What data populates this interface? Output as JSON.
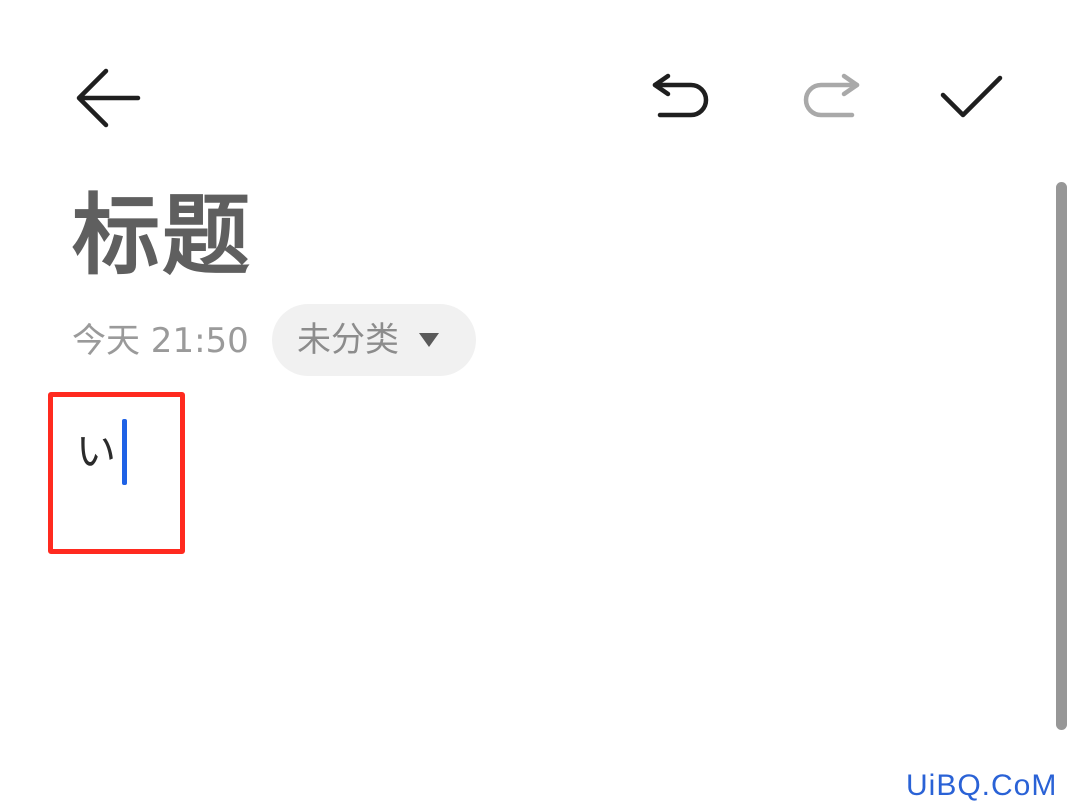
{
  "toolbar": {
    "back_icon": "arrow-left-icon",
    "undo_icon": "undo-icon",
    "redo_icon": "redo-icon",
    "save_icon": "check-icon",
    "icon_color": "#1f1f1f",
    "redo_disabled_color": "#a9a9a9"
  },
  "note": {
    "title": "标题",
    "time": "今天 21:50",
    "category": "未分类",
    "category_icon": "dropdown-triangle-icon",
    "body": "い"
  },
  "watermark": "UiBQ.CoM",
  "colors": {
    "highlight_border": "#ff2a1f",
    "caret": "#1f62e6",
    "title_text": "#5f5f5f",
    "meta_text": "#9a9a9a",
    "chip_background": "#f1f1f1",
    "watermark_text": "#2a62d6"
  }
}
